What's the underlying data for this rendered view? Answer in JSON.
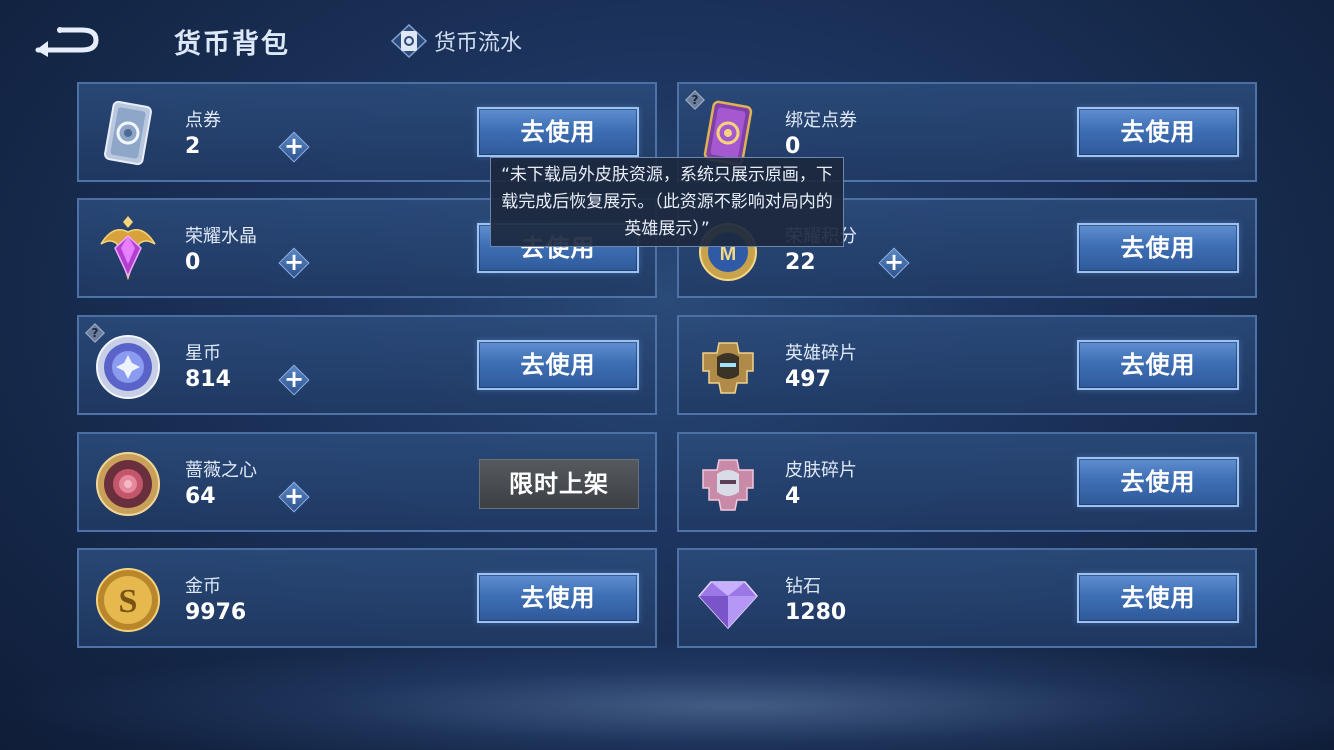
{
  "header": {
    "title": "货币背包",
    "flow_tab": "货币流水"
  },
  "tooltip": {
    "text": "“未下载局外皮肤资源，系统只展示原画，下载完成后恢复展示。（此资源不影响对局内的英雄展示）”"
  },
  "left": [
    {
      "name": "点券",
      "amount": "2",
      "button": "去使用",
      "icon": "voucher-card-icon",
      "plus": "+"
    },
    {
      "name": "荣耀水晶",
      "amount": "0",
      "button": "去使用",
      "icon": "glory-crystal-icon",
      "plus": "+"
    },
    {
      "name": "星币",
      "amount": "814",
      "button": "去使用",
      "icon": "star-coin-icon",
      "plus": "+",
      "help": "?"
    },
    {
      "name": "蔷薇之心",
      "amount": "64",
      "button": "限时上架",
      "icon": "rose-heart-icon",
      "plus": "+"
    },
    {
      "name": "金币",
      "amount": "9976",
      "button": "去使用",
      "icon": "gold-coin-icon"
    }
  ],
  "right": [
    {
      "name": "绑定点券",
      "amount": "0",
      "button": "去使用",
      "icon": "bound-voucher-icon",
      "help": "?"
    },
    {
      "name": "荣耀积分",
      "amount": "22",
      "button": "去使用",
      "icon": "glory-points-icon",
      "plus": "+"
    },
    {
      "name": "英雄碎片",
      "amount": "497",
      "button": "去使用",
      "icon": "hero-fragment-icon"
    },
    {
      "name": "皮肤碎片",
      "amount": "4",
      "button": "去使用",
      "icon": "skin-fragment-icon"
    },
    {
      "name": "钻石",
      "amount": "1280",
      "button": "去使用",
      "icon": "diamond-icon"
    }
  ]
}
